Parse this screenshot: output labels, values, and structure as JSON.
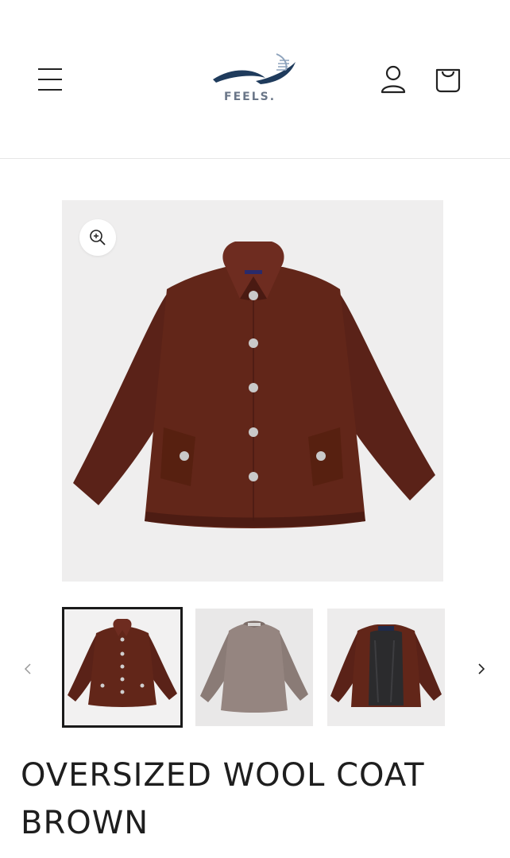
{
  "header": {
    "brand_name": "FEELS.",
    "menu_icon": "hamburger-icon",
    "account_icon": "user-icon",
    "cart_icon": "bag-icon"
  },
  "gallery": {
    "zoom_icon": "zoom-in-icon",
    "main_image": "brown-wool-coat-front",
    "thumbnails": [
      {
        "image": "brown-wool-coat-front",
        "selected": true
      },
      {
        "image": "coat-back-grey-brown",
        "selected": false
      },
      {
        "image": "coat-open-lining",
        "selected": false
      }
    ],
    "prev_icon": "chevron-left-icon",
    "next_icon": "chevron-right-icon"
  },
  "product": {
    "title": "OVERSIZED WOOL COAT BROWN"
  },
  "colors": {
    "coat_brown": "#5a2218",
    "coat_brown_light": "#6e2c20",
    "image_bg": "#efeeee",
    "logo_navy": "#1f3b5c",
    "header_border": "#e6e6e6"
  }
}
